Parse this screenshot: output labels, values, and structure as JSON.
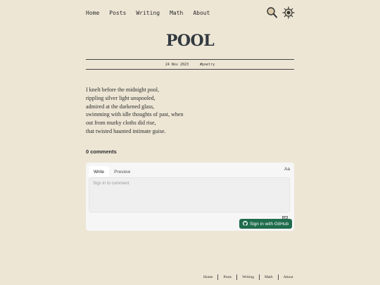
{
  "nav": {
    "items": [
      "Home",
      "Posts",
      "Writing",
      "Math",
      "About"
    ],
    "icons": [
      "search-icon",
      "theme-toggle-icon"
    ]
  },
  "post": {
    "title": "POOL",
    "date": "24 Nov 2023",
    "tag": "#poetry",
    "lines": [
      "I knelt before the midnight pool,",
      "rippling silver light unspooled,",
      "admired at the darkened glass,",
      "swimming with idle thoughts of past, when",
      "out from murky cloths did rise,",
      "that twisted haunted intimate guise."
    ]
  },
  "comments": {
    "count_label": "0 comments",
    "tab_write": "Write",
    "tab_preview": "Preview",
    "aa_label": "Aa",
    "placeholder": "Sign in to comment",
    "signin_label": "Sign in with GitHub",
    "accent": "#1f6c4d"
  },
  "footer": {
    "items": [
      "Home",
      "Posts",
      "Writing",
      "Math",
      "About"
    ]
  },
  "colors": {
    "background": "#ede6d5",
    "text": "#2b2b2b"
  }
}
